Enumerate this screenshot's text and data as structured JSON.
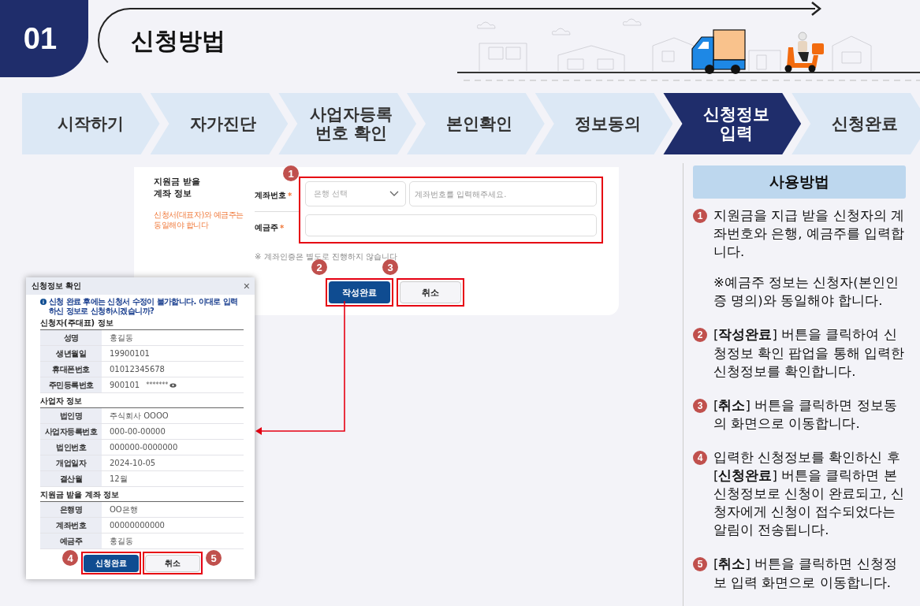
{
  "header": {
    "number": "01",
    "title": "신청방법"
  },
  "steps": [
    {
      "label": "시작하기",
      "selected": false
    },
    {
      "label": "자가진단",
      "selected": false
    },
    {
      "label": "사업자등록\n번호 확인",
      "selected": false
    },
    {
      "label": "본인확인",
      "selected": false
    },
    {
      "label": "정보동의",
      "selected": false
    },
    {
      "label": "신청정보\n입력",
      "selected": true
    },
    {
      "label": "신청완료",
      "selected": false
    }
  ],
  "form": {
    "section_title": "지원금 받을\n계좌 정보",
    "section_note": "신청서(대표자)와 예금주는\n동일해야 합니다",
    "marker": "1",
    "fields": [
      {
        "label": "계좌번호",
        "required_mark": "*",
        "select_placeholder": "은행 선택",
        "placeholder": "계좌번호를 입력해주세요."
      },
      {
        "label": "예금주",
        "required_mark": "*"
      }
    ],
    "notice": "※ 계좌인증은 별도로 진행하지 않습니다",
    "buttons": [
      {
        "label": "작성완료",
        "kind": "primary",
        "marker": "2"
      },
      {
        "label": "취소",
        "kind": "secondary",
        "marker": "3"
      }
    ]
  },
  "popup": {
    "title": "신청정보 확인",
    "close": "×",
    "info": "신청 완료 후에는 신청서 수정이 불가합니다. 이대로 입력하신 정보로 신청하시겠습니까?",
    "sections": [
      {
        "title": "신청자(주대표) 정보",
        "rows": [
          {
            "label": "성명",
            "value": "홍길동"
          },
          {
            "label": "생년월일",
            "value": "19900101"
          },
          {
            "label": "휴대폰번호",
            "value": "01012345678"
          },
          {
            "label": "주민등록번호",
            "value": "900101",
            "masked_value": "*******"
          }
        ]
      },
      {
        "title": "사업자 정보",
        "rows": [
          {
            "label": "법인명",
            "value": "주식회사 OOOO"
          },
          {
            "label": "사업자등록번호",
            "value": "000-00-00000"
          },
          {
            "label": "법인번호",
            "value": "000000-0000000"
          },
          {
            "label": "개업일자",
            "value": "2024-10-05"
          },
          {
            "label": "결산월",
            "value": "12월"
          }
        ]
      },
      {
        "title": "지원금 받을 계좌 정보",
        "rows": [
          {
            "label": "은행명",
            "value": "OO은행"
          },
          {
            "label": "계좌번호",
            "value": "00000000000"
          },
          {
            "label": "예금주",
            "value": "홍길동"
          }
        ]
      }
    ],
    "buttons": [
      {
        "label": "신청완료",
        "kind": "primary",
        "marker": "4"
      },
      {
        "label": "취소",
        "kind": "secondary",
        "marker": "5"
      }
    ]
  },
  "guide": {
    "title": "사용방법",
    "items": [
      {
        "number": "1",
        "text": "지원금을 지급 받을 신청자의 계좌번호와 은행, 예금주를 입력합니다.",
        "note": "※예금주 정보는 신청자(본인인증 명의)와 동일해야 합니다."
      },
      {
        "number": "2",
        "text": "[**작성완료**] 버튼을 클릭하여 신청정보 확인 팝업을 통해 입력한 신청정보를 확인합니다."
      },
      {
        "number": "3",
        "text": "[**취소**] 버튼을 클릭하면 정보동의 화면으로 이동합니다."
      },
      {
        "number": "4",
        "text": "입력한 신청정보를 확인하신 후 [**신청완료**] 버튼을 클릭하면 본 신청정보로 신청이 완료되고, 신청자에게 신청이 접수되었다는 알림이 전송됩니다."
      },
      {
        "number": "5",
        "text": "[**취소**] 버튼을 클릭하면 신청정보 입력 화면으로 이동합니다."
      }
    ]
  }
}
